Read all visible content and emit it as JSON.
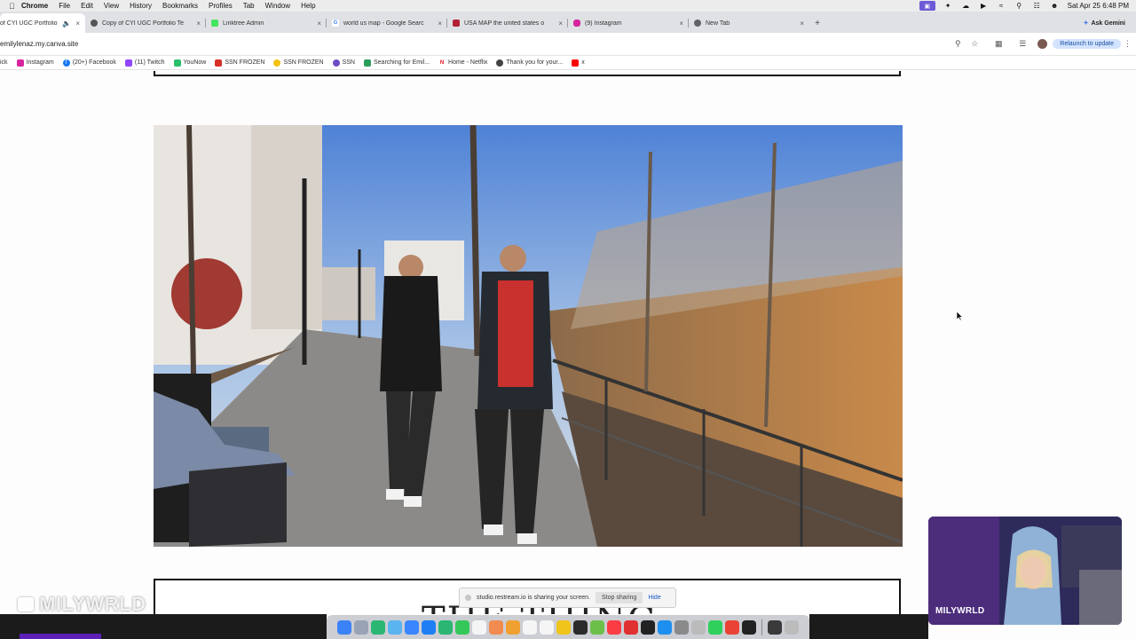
{
  "menubar": {
    "app": "Chrome",
    "menus": [
      "File",
      "Edit",
      "View",
      "History",
      "Bookmarks",
      "Profiles",
      "Tab",
      "Window",
      "Help"
    ],
    "datetime": "Sat Apr 25  6:48 PM"
  },
  "tabs": [
    {
      "title": "of CYI UGC Portfolio",
      "color": "#ffffff"
    },
    {
      "title": "Copy of CYI UGC Portfolio Te",
      "color": "#555555"
    },
    {
      "title": "Linktree Admin",
      "color": "#43e55e"
    },
    {
      "title": "world us map - Google Searc",
      "color": "#4285f4"
    },
    {
      "title": "USA MAP the united states o",
      "color": "#b22234"
    },
    {
      "title": "(9) Instagram",
      "color": "#d6249f"
    },
    {
      "title": "New Tab",
      "color": "#5f6368"
    }
  ],
  "toolbar": {
    "url": "emilylenaz.my.canva.site",
    "gemini_label": "Ask Gemini",
    "relaunch_label": "Relaunch to update"
  },
  "bookmarks": [
    {
      "label": "ick",
      "color": ""
    },
    {
      "label": "Instagram",
      "color": "#d6249f"
    },
    {
      "label": "(20+) Facebook",
      "color": "#1877f2"
    },
    {
      "label": "(11) Twitch",
      "color": "#9146ff"
    },
    {
      "label": "YouNow",
      "color": "#2bbf6a"
    },
    {
      "label": "SSN FROZEN",
      "color": "#d93025"
    },
    {
      "label": "SSN FROZEN",
      "color": "#f4c20d"
    },
    {
      "label": "SSN",
      "color": "#6d4cc4"
    },
    {
      "label": "Searching for Emil...",
      "color": "#2a9d5c"
    },
    {
      "label": "Home - Netflix",
      "color": "#e50914"
    },
    {
      "label": "Thank you for your...",
      "color": "#444444"
    },
    {
      "label": "x",
      "color": "#ff0000"
    }
  ],
  "page": {
    "section_title_partial": "THE THING"
  },
  "share_bar": {
    "message": "studio.restream.io is sharing your screen.",
    "stop_label": "Stop sharing",
    "hide_label": "Hide"
  },
  "watermark": "MILYWRLD",
  "webcam_label": "MILYWRLD",
  "dock_colors": [
    "#3b82f6",
    "#9aa3b5",
    "#2bb673",
    "#5ab4f0",
    "#3a86ff",
    "#1e7ff5",
    "#2bb673",
    "#34c759",
    "#f5f5f5",
    "#f28b50",
    "#f0a030",
    "#f5f5f5",
    "#f5f5f5",
    "#f0c419",
    "#2b2b2b",
    "#6cc04a",
    "#fc3c44",
    "#e03030",
    "#222222",
    "#1d8ff0",
    "#8a8a8a",
    "#bbbbbb",
    "#2fd05c",
    "#ea4335",
    "#222222",
    "#3a3a3a",
    "#bcbcbc"
  ]
}
